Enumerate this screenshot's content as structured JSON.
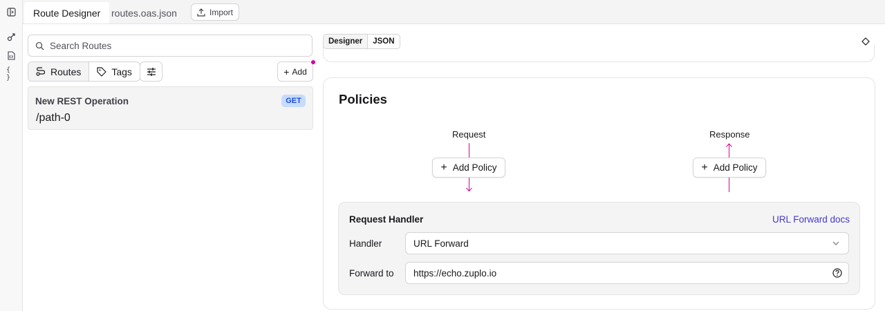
{
  "tabs": [
    {
      "label": "Route Designer",
      "active": true
    },
    {
      "label": "routes.oas.json",
      "active": false
    }
  ],
  "toolbar": {
    "import_label": "Import"
  },
  "sidebar_rail": {
    "icons": [
      "panel-toggle-icon",
      "route-icon",
      "file-code-icon",
      "braces-icon"
    ]
  },
  "left_panel": {
    "search": {
      "placeholder": "Search Routes",
      "value": ""
    },
    "segments": [
      {
        "label": "Routes",
        "icon": "route-icon",
        "selected": true
      },
      {
        "label": "Tags",
        "icon": "tag-icon",
        "selected": false
      }
    ],
    "add_label": "Add",
    "routes": [
      {
        "name": "New REST Operation",
        "path": "/path-0",
        "method": "GET"
      }
    ]
  },
  "right_panel": {
    "view_toggle": [
      {
        "label": "Designer",
        "selected": true
      },
      {
        "label": "JSON",
        "selected": false
      }
    ],
    "policies": {
      "title": "Policies",
      "request": {
        "label": "Request",
        "button": "Add Policy"
      },
      "response": {
        "label": "Response",
        "button": "Add Policy"
      }
    },
    "request_handler": {
      "title": "Request Handler",
      "docs_link": "URL Forward docs",
      "handler_label": "Handler",
      "handler_value": "URL Forward",
      "forward_label": "Forward to",
      "forward_value": "https://echo.zuplo.io"
    }
  },
  "colors": {
    "accent": "#d6009a",
    "link": "#4338ca",
    "badge_bg": "#c7dcf9",
    "badge_text": "#1d4ed8"
  }
}
